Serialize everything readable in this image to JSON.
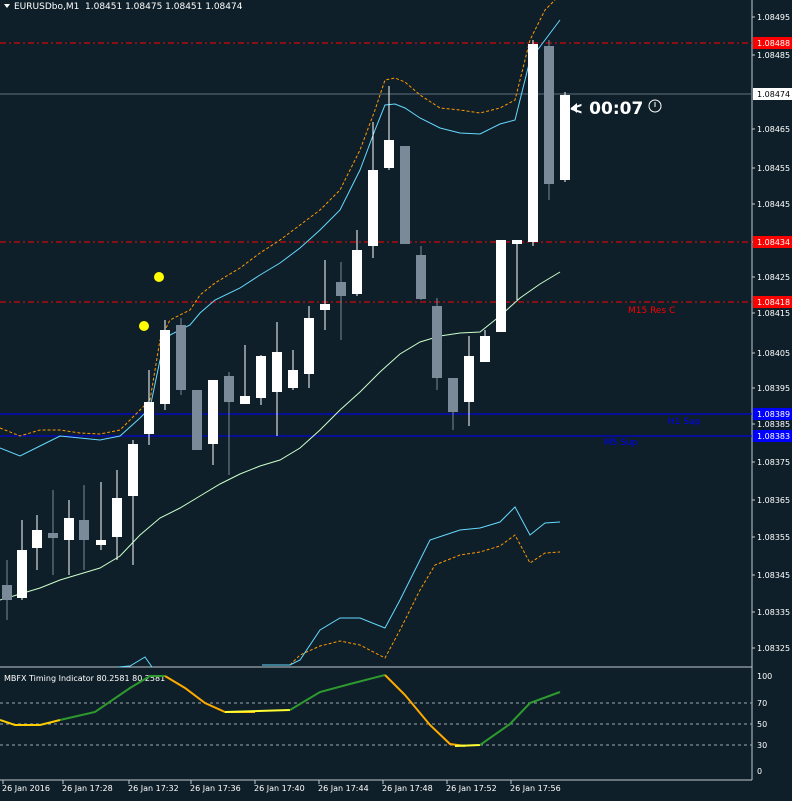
{
  "header": {
    "symbol_label": "EURUSDbo,M1",
    "ohlc_label": "1.08451 1.08475 1.08451 1.08474",
    "menu_icon": "triangle-down-icon"
  },
  "price_axis": {
    "labels": [
      "1.08495",
      "1.08485",
      "1.08474",
      "1.08465",
      "1.08455",
      "1.08445",
      "1.08435",
      "1.08425",
      "1.08415",
      "1.08405",
      "1.08395",
      "1.08385",
      "1.08375",
      "1.08365",
      "1.08355",
      "1.08345",
      "1.08335",
      "1.08325"
    ],
    "marks": {
      "res1": {
        "text": "1.08488",
        "bg": "#ff0000"
      },
      "current": {
        "text": "1.08474",
        "bg": "#ffffff"
      },
      "res2": {
        "text": "1.08434",
        "bg": "#ff0000"
      },
      "res3": {
        "text": "1.08418",
        "bg": "#ff0000"
      },
      "sup1": {
        "text": "1.08389",
        "bg": "#0000ff"
      },
      "sup2": {
        "text": "1.08383",
        "bg": "#0000ff"
      }
    }
  },
  "levels": {
    "m15_res": "M15 Res C",
    "h1_sup": "H1 Sup",
    "m5_sup": "M5 Sup"
  },
  "countdown": {
    "text": "< 00:07",
    "clock_icon": "clock-icon"
  },
  "indicator": {
    "label": "MBFX Timing Indicator 80.2581 80.2581",
    "axis": [
      "100",
      "70",
      "50",
      "30",
      "0"
    ]
  },
  "time_axis": {
    "labels": [
      "26 Jan 2016",
      "26 Jan 17:28",
      "26 Jan 17:32",
      "26 Jan 17:36",
      "26 Jan 17:40",
      "26 Jan 17:44",
      "26 Jan 17:48",
      "26 Jan 17:52",
      "26 Jan 17:56"
    ]
  },
  "colors": {
    "background": "#0e1f29",
    "bull": "#ffffff",
    "bear": "#7a8a99",
    "resistance": "#ff0000",
    "support": "#0000ff",
    "upper_band": "#ff9900",
    "mid_band": "#66d9ff",
    "ma": "#ccffcc"
  }
}
